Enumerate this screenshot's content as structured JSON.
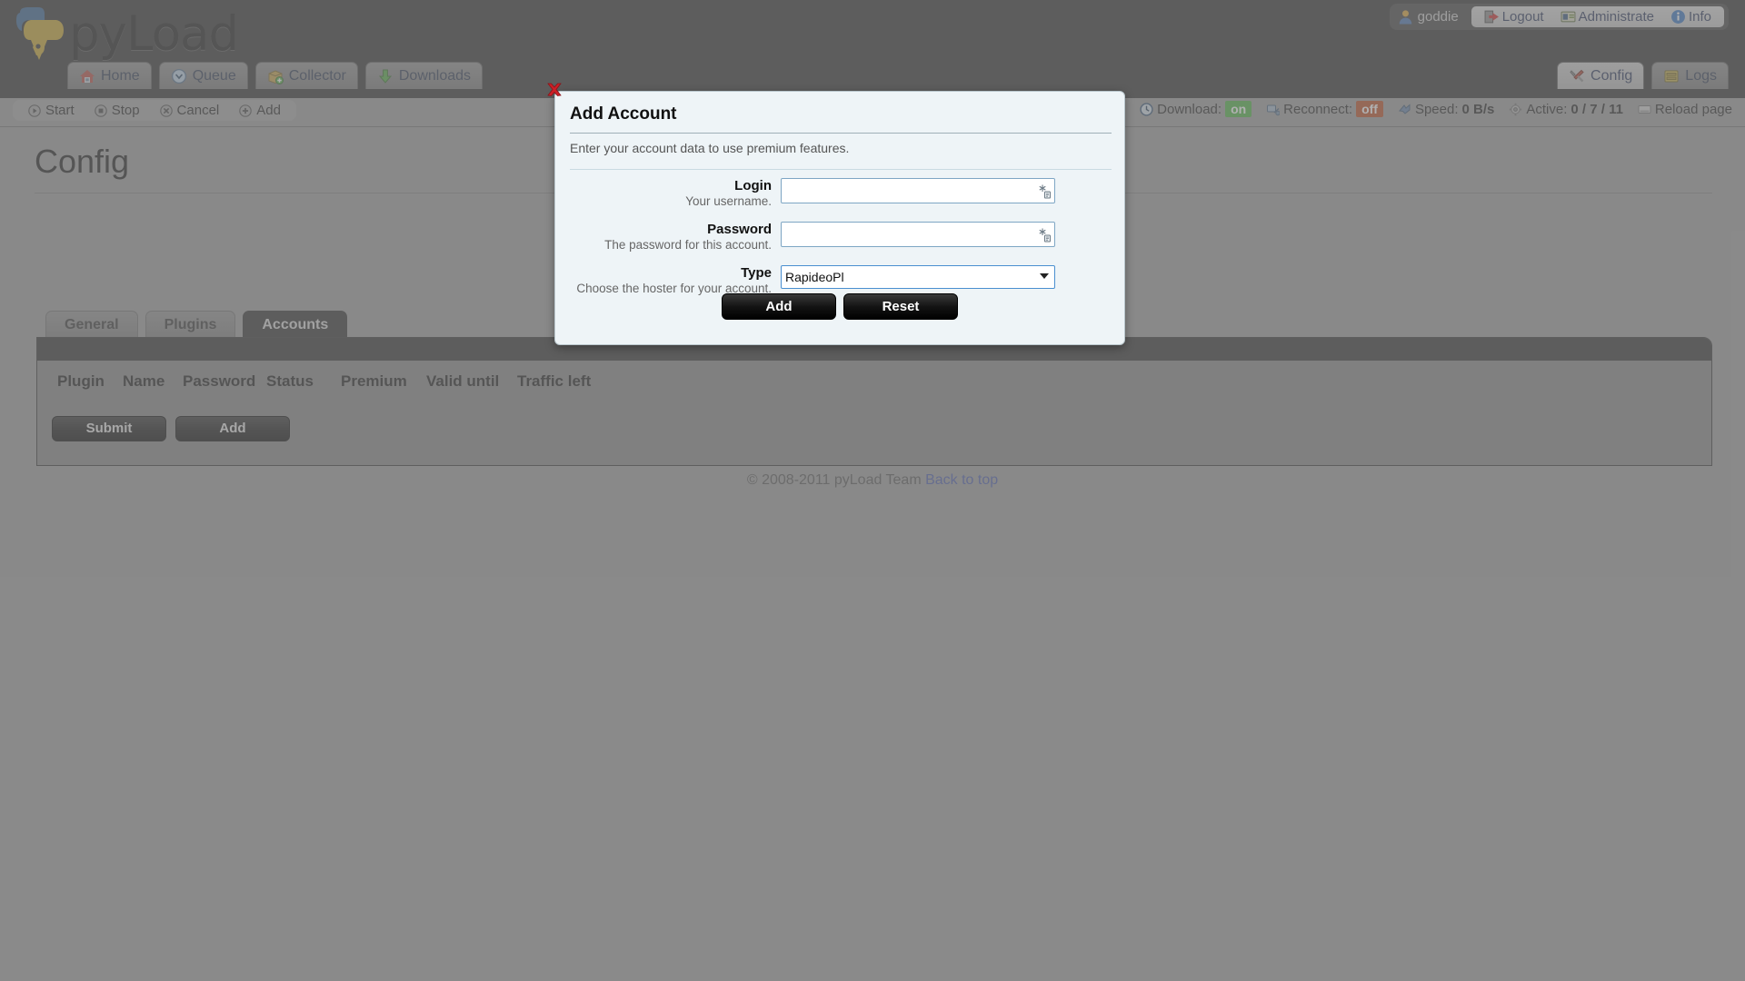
{
  "app": {
    "brand": "pyLoad"
  },
  "userbar": {
    "username": "goddie",
    "links": [
      {
        "label": "Logout",
        "icon": "logout-icon"
      },
      {
        "label": "Administrate",
        "icon": "id-card-icon"
      },
      {
        "label": "Info",
        "icon": "info-icon"
      }
    ]
  },
  "nav": {
    "left": [
      {
        "label": "Home",
        "icon": "home-icon",
        "active": false
      },
      {
        "label": "Queue",
        "icon": "clock-icon",
        "active": false
      },
      {
        "label": "Collector",
        "icon": "box-icon",
        "active": false
      },
      {
        "label": "Downloads",
        "icon": "download-arrow-icon",
        "active": false
      }
    ],
    "right": [
      {
        "label": "Config",
        "icon": "tools-icon",
        "active": true
      },
      {
        "label": "Logs",
        "icon": "logs-icon",
        "active": false
      }
    ]
  },
  "actionbar": {
    "actions": [
      {
        "label": "Start",
        "icon": "play-icon"
      },
      {
        "label": "Stop",
        "icon": "stop-icon"
      },
      {
        "label": "Cancel",
        "icon": "cancel-icon"
      },
      {
        "label": "Add",
        "icon": "plus-icon"
      }
    ],
    "status": {
      "download_label": "Download:",
      "download_value": "on",
      "reconnect_label": "Reconnect:",
      "reconnect_value": "off",
      "speed_label": "Speed:",
      "speed_value": "0 B/s",
      "active_label": "Active:",
      "active_value": "0 / 7 / 11",
      "reload_label": "Reload page"
    }
  },
  "page": {
    "title": "Config",
    "tabs": [
      {
        "label": "General",
        "active": false
      },
      {
        "label": "Plugins",
        "active": false
      },
      {
        "label": "Accounts",
        "active": true
      }
    ],
    "table": {
      "columns": [
        "Plugin",
        "Name",
        "Password",
        "Status",
        "Premium",
        "Valid until",
        "Traffic left"
      ]
    },
    "buttons": [
      {
        "label": "Submit"
      },
      {
        "label": "Add"
      }
    ]
  },
  "footer": {
    "copyright": "© 2008-2011 pyLoad Team",
    "back_to_top": "Back to top"
  },
  "dialog": {
    "title": "Add Account",
    "subtitle": "Enter your account data to use premium features.",
    "close_icon": "close-icon",
    "fields": [
      {
        "label": "Login",
        "hint": "Your username.",
        "value": "",
        "placeholder": "",
        "type": "text"
      },
      {
        "label": "Password",
        "hint": "The password for this account.",
        "value": "",
        "placeholder": "",
        "type": "password"
      }
    ],
    "type_field": {
      "label": "Type",
      "hint": "Choose the hoster for your account.",
      "value": "RapideoPl",
      "options": [
        "RapideoPl"
      ]
    },
    "buttons": [
      {
        "label": "Add"
      },
      {
        "label": "Reset"
      }
    ]
  },
  "colors": {
    "header_bg": "#272727",
    "page_bg": "#9a9a9a",
    "dialog_bg": "#eef4f7",
    "status_on": "#46b03a",
    "status_off": "#b8441a",
    "link": "#3f53a8"
  }
}
